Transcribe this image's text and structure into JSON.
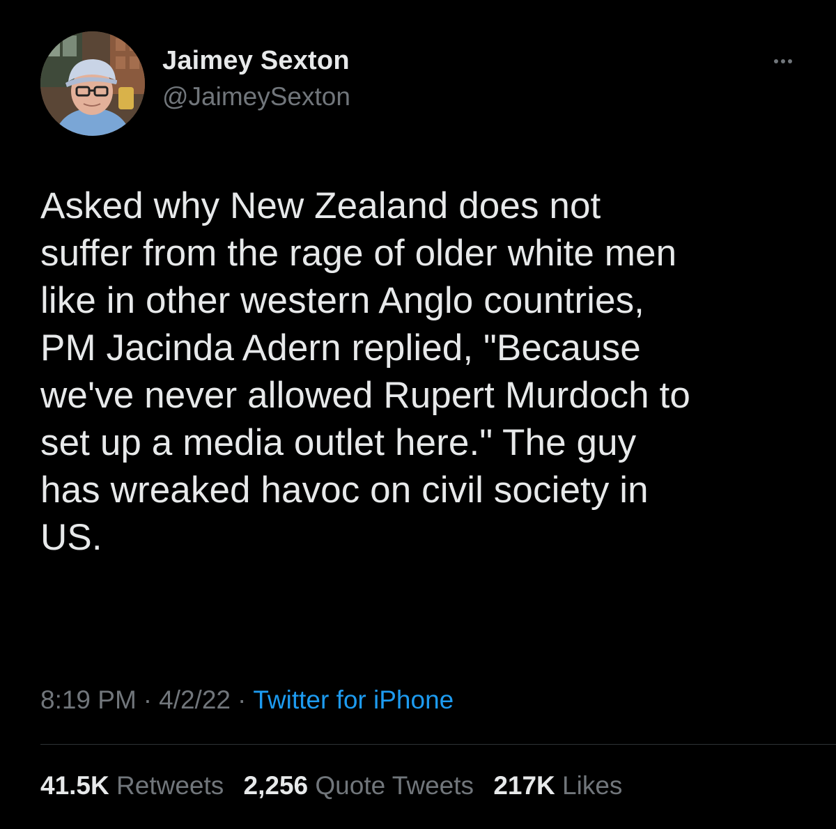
{
  "author": {
    "display_name": "Jaimey Sexton",
    "handle": "@JaimeySexton",
    "avatar_icon": "profile-photo"
  },
  "more_icon": "more-dots-icon",
  "tweet": {
    "text": "Asked why New Zealand does not\nsuffer from the rage of older white men\nlike in other western Anglo countries,\nPM Jacinda Adern replied, \"Because\nwe've never allowed Rupert Murdoch to\nset up a media outlet here.\" The guy\nhas wreaked havoc on civil society in\nUS."
  },
  "meta": {
    "time": "8:19 PM",
    "separator": "·",
    "date": "4/2/22",
    "source": "Twitter for iPhone"
  },
  "stats": {
    "retweets_count": "41.5K",
    "retweets_label": "Retweets",
    "quotes_count": "2,256",
    "quotes_label": "Quote Tweets",
    "likes_count": "217K",
    "likes_label": "Likes"
  },
  "colors": {
    "background": "#000000",
    "text_primary": "#e7e9ea",
    "text_secondary": "#71767b",
    "accent": "#1d9bf0",
    "divider": "#2f3336"
  }
}
